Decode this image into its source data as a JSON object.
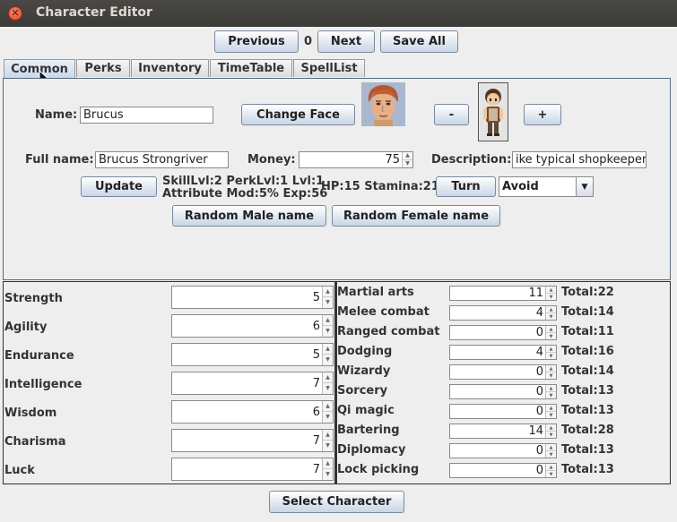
{
  "window": {
    "title": "Character Editor"
  },
  "toolbar": {
    "previous": "Previous",
    "index": "0",
    "next": "Next",
    "save_all": "Save All"
  },
  "tabs": [
    "Common",
    "Perks",
    "Inventory",
    "TimeTable",
    "SpellList"
  ],
  "common": {
    "name_label": "Name:",
    "name_value": "Brucus",
    "change_face": "Change Face",
    "minus": "-",
    "plus": "+",
    "fullname_label": "Full name:",
    "fullname_value": "Brucus Strongriver",
    "money_label": "Money:",
    "money_value": "75",
    "description_label": "Description:",
    "description_value": "ike typical shopkeeper.",
    "update": "Update",
    "info_line1": "SkillLvl:2 PerkLvl:1 Lvl:1",
    "info_line2": "Attribute Mod:5% Exp:56",
    "hp_stamina": "HP:15 Stamina:21",
    "turn": "Turn",
    "ai_mode": "Avoid",
    "random_male": "Random Male name",
    "random_female": "Random Female name"
  },
  "attributes": [
    {
      "label": "Strength",
      "value": "5"
    },
    {
      "label": "Agility",
      "value": "6"
    },
    {
      "label": "Endurance",
      "value": "5"
    },
    {
      "label": "Intelligence",
      "value": "7"
    },
    {
      "label": "Wisdom",
      "value": "6"
    },
    {
      "label": "Charisma",
      "value": "7"
    },
    {
      "label": "Luck",
      "value": "7"
    }
  ],
  "skills": [
    {
      "label": "Martial arts",
      "value": "11",
      "total": "Total:22"
    },
    {
      "label": "Melee combat",
      "value": "4",
      "total": "Total:14"
    },
    {
      "label": "Ranged combat",
      "value": "0",
      "total": "Total:11"
    },
    {
      "label": "Dodging",
      "value": "4",
      "total": "Total:16"
    },
    {
      "label": "Wizardy",
      "value": "0",
      "total": "Total:14"
    },
    {
      "label": "Sorcery",
      "value": "0",
      "total": "Total:13"
    },
    {
      "label": "Qi magic",
      "value": "0",
      "total": "Total:13"
    },
    {
      "label": "Bartering",
      "value": "14",
      "total": "Total:28"
    },
    {
      "label": "Diplomacy",
      "value": "0",
      "total": "Total:13"
    },
    {
      "label": "Lock picking",
      "value": "0",
      "total": "Total:13"
    }
  ],
  "footer": {
    "select_character": "Select Character"
  },
  "colors": {
    "button_top": "#ffffff",
    "button_bottom": "#c8d6e6",
    "close_red": "#df4a23",
    "titlebar": "#3c3b37"
  }
}
